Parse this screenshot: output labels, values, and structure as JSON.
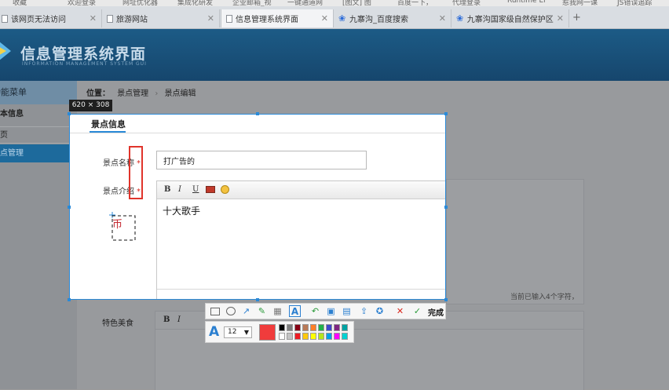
{
  "browser": {
    "bookmarks": [
      "收藏",
      "欢迎登录",
      "网址优化器",
      "集成化研发",
      "企业邮箱_视",
      "一键通道网",
      "[图文] 图",
      "百度一下，",
      "代理登录",
      "Runtime Er",
      "惹我网一课",
      "JS错误追踪"
    ],
    "tabs": [
      {
        "label": "该网页无法访问",
        "active": false,
        "icon": "page-icon"
      },
      {
        "label": "旅游网站",
        "active": false,
        "icon": "page-icon"
      },
      {
        "label": "信息管理系统界面",
        "active": true,
        "icon": "page-icon"
      },
      {
        "label": "九寨沟_百度搜索",
        "active": false,
        "icon": "baidu-paw-icon"
      },
      {
        "label": "九寨沟国家级自然保护区",
        "active": false,
        "icon": "baidu-paw-icon"
      }
    ],
    "new_tab": "+",
    "close_glyph": "✕"
  },
  "app": {
    "title": "信息管理系统界面",
    "subtitle": "INFORMATION MANAGEMENT SYSTEM GUI"
  },
  "sidebar": {
    "header": "功能菜单",
    "section": "基本信息",
    "items": [
      "首页",
      "景点管理"
    ],
    "active_index": 1
  },
  "breadcrumb": {
    "label": "位置：",
    "items": [
      "景点管理",
      "景点编辑"
    ],
    "separator": "›"
  },
  "selection": {
    "size_label": "620 × 308"
  },
  "form": {
    "tab_title": "景点信息",
    "name_label": "景点名称",
    "name_value": "打广告的",
    "intro_label": "景点介绍",
    "required_mark": "*",
    "intro_value": "十大歌手",
    "char_count": "当前已输入4个字符，",
    "special_food_label": "特色美食",
    "editor_buttons": [
      "B",
      "I",
      "U"
    ]
  },
  "tool": {
    "done_label": "完成",
    "font_size": "12",
    "current_color": "#f03c3c",
    "palette": [
      "#000000",
      "#7f7f7f",
      "#880015",
      "#b97a57",
      "#ff7f27",
      "#22b14c",
      "#3f48cc",
      "#7f2682",
      "#00a2a2",
      "#ffffff",
      "#c3c3c3",
      "#ed1c24",
      "#ffc90e",
      "#ffff00",
      "#b5e61d",
      "#00a2e8",
      "#ff00ff",
      "#00d2d2"
    ]
  },
  "colors": {
    "accent": "#2a8ad8",
    "header": "#16466d",
    "required": "#d9261c"
  }
}
